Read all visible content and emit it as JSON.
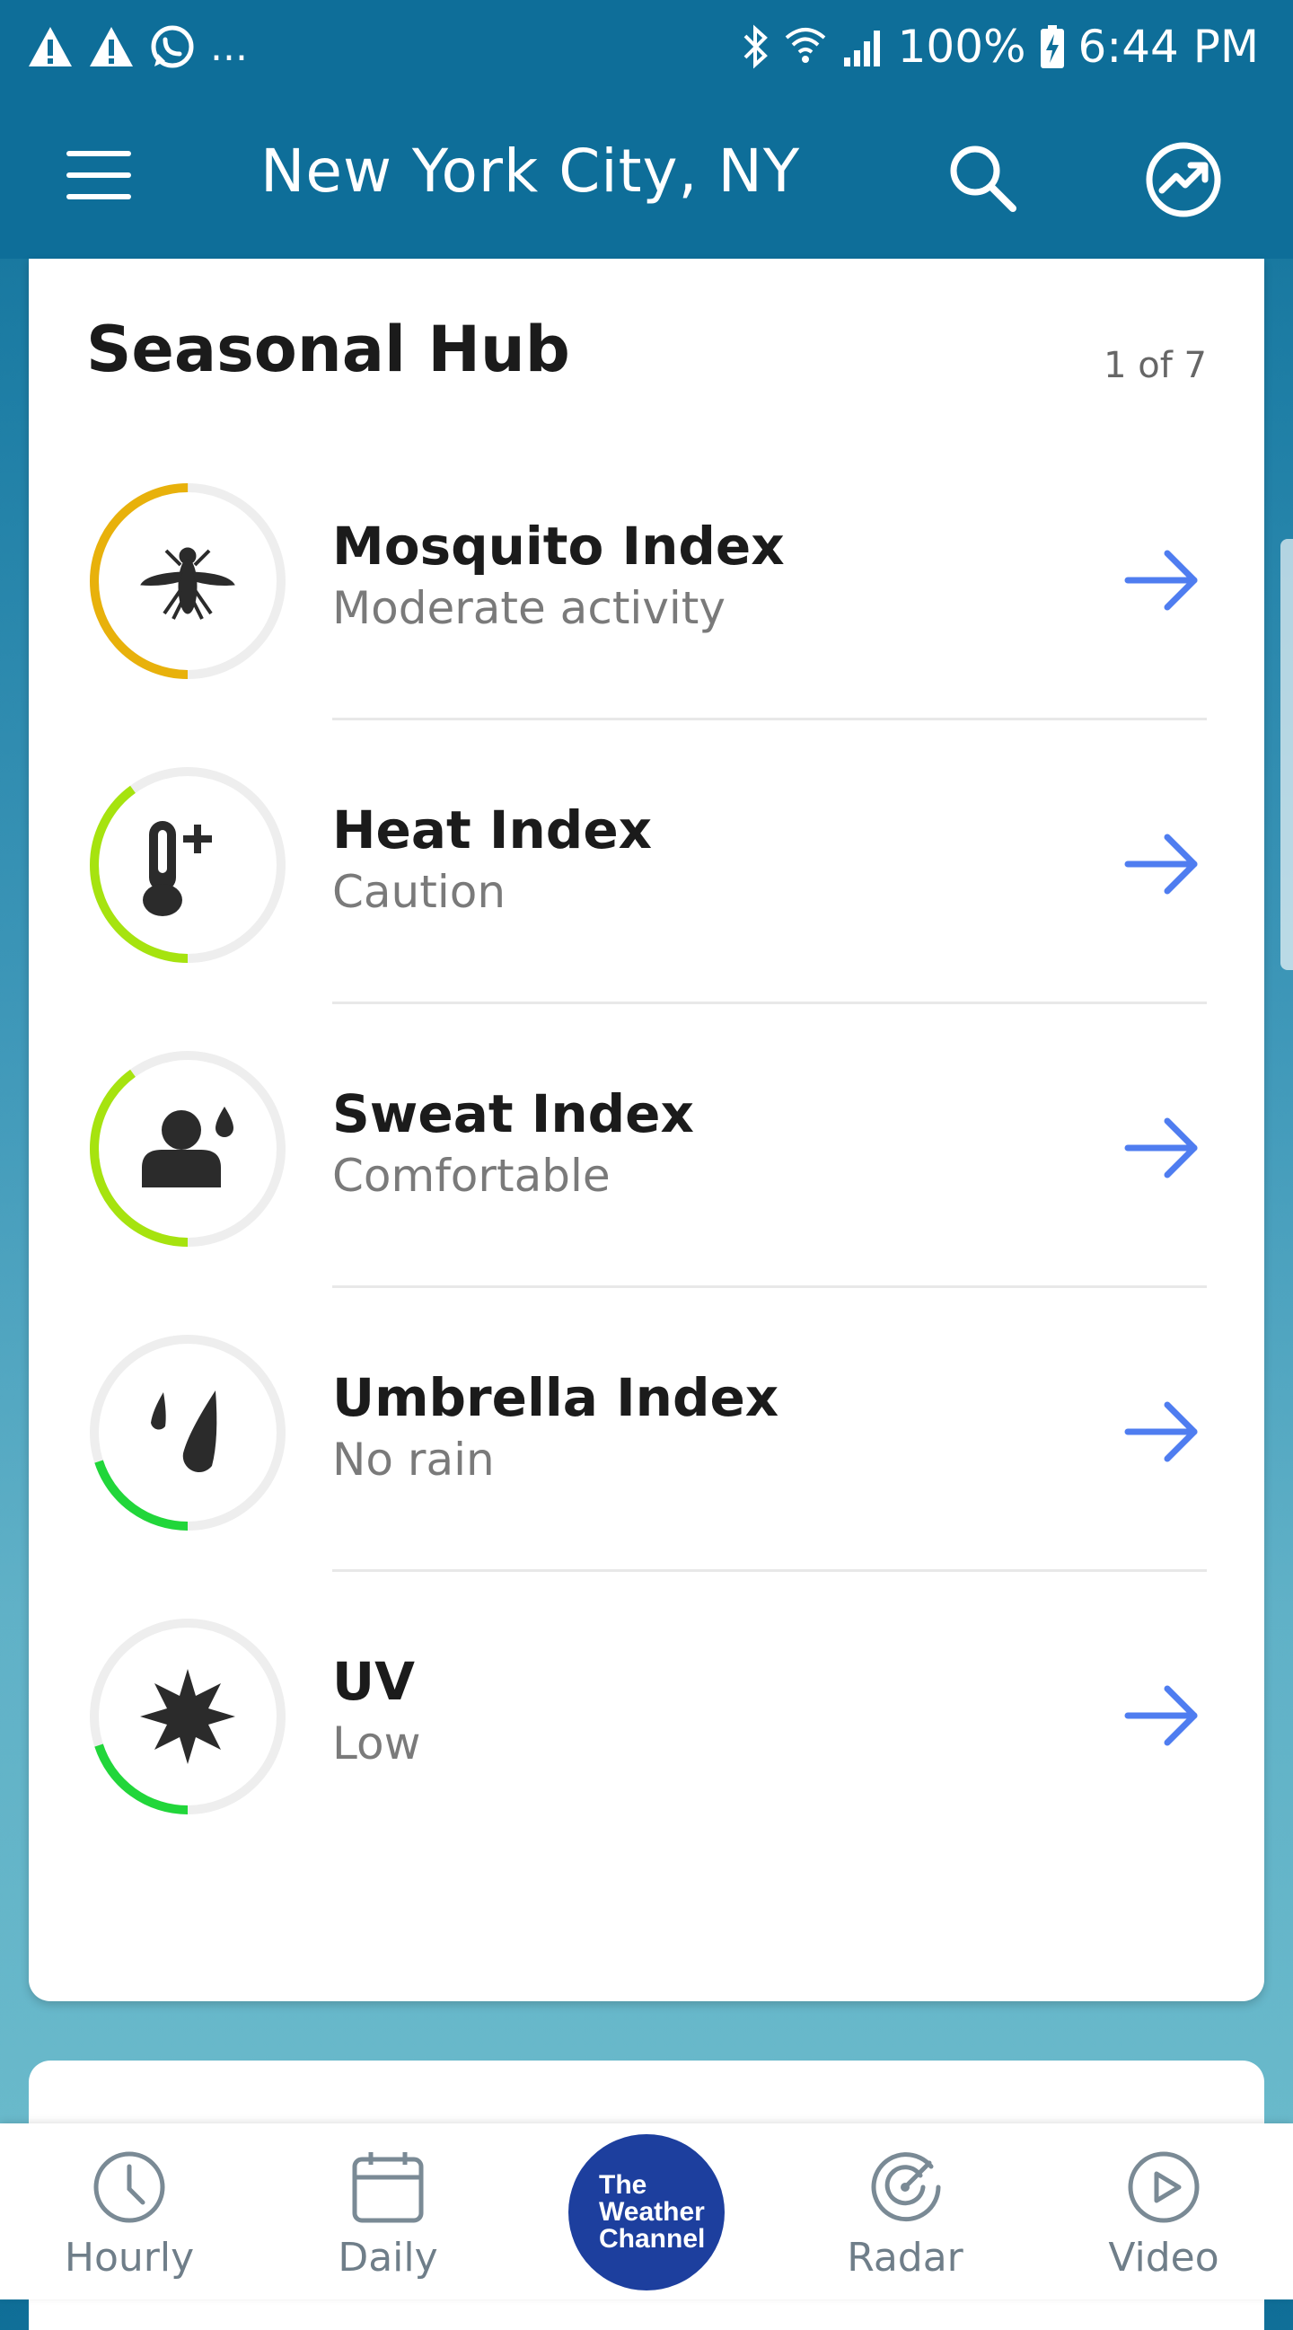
{
  "status_bar": {
    "left_dots": "...",
    "battery": "100%",
    "time": "6:44 PM"
  },
  "app_bar": {
    "location": "New York City, NY"
  },
  "seasonal_hub": {
    "title": "Seasonal Hub",
    "page_indicator": "1 of 7",
    "items": [
      {
        "name": "Mosquito Index",
        "status": "Moderate activity",
        "icon": "mosquito-icon",
        "ring_color": "#e8b10b",
        "level": 0.5
      },
      {
        "name": "Heat Index",
        "status": "Caution",
        "icon": "thermometer-plus-icon",
        "ring_color": "#a6e30f",
        "level": 0.4
      },
      {
        "name": "Sweat Index",
        "status": "Comfortable",
        "icon": "person-sweat-icon",
        "ring_color": "#a6e30f",
        "level": 0.4
      },
      {
        "name": "Umbrella Index",
        "status": "No rain",
        "icon": "raindrop-icon",
        "ring_color": "#21d63a",
        "level": 0.2
      },
      {
        "name": "UV",
        "status": "Low",
        "icon": "sun-icon",
        "ring_color": "#21d63a",
        "level": 0.2
      }
    ],
    "accent_color": "#4f7df0"
  },
  "bottom_nav": {
    "items": [
      {
        "label": "Hourly",
        "icon": "clock-icon"
      },
      {
        "label": "Daily",
        "icon": "calendar-icon"
      },
      {
        "label": "Radar",
        "icon": "radar-icon"
      },
      {
        "label": "Video",
        "icon": "play-icon"
      }
    ],
    "center_logo": {
      "line1": "The",
      "line2": "Weather",
      "line3": "Channel"
    }
  }
}
